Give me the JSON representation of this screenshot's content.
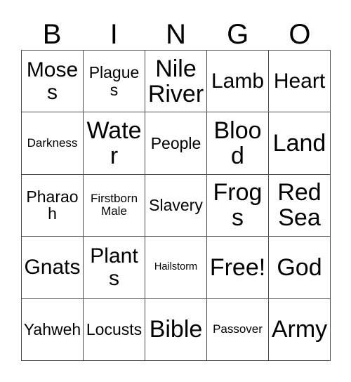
{
  "card": {
    "title_letters": [
      "B",
      "I",
      "N",
      "G",
      "O"
    ],
    "columns": [
      "B",
      "I",
      "N",
      "G",
      "O"
    ],
    "background_color": "#ffffff",
    "text_color": "#000000",
    "border_color": "#4d4d4d",
    "rows": [
      [
        {
          "text": "Moses",
          "size": "lg"
        },
        {
          "text": "Plagues",
          "size": "md"
        },
        {
          "text": "Nile\nRiver",
          "size": "xl"
        },
        {
          "text": "Lamb",
          "size": "lg"
        },
        {
          "text": "Heart",
          "size": "lg"
        }
      ],
      [
        {
          "text": "Darkness",
          "size": "sm"
        },
        {
          "text": "Water",
          "size": "xl"
        },
        {
          "text": "People",
          "size": "md"
        },
        {
          "text": "Blood",
          "size": "xl"
        },
        {
          "text": "Land",
          "size": "xl"
        }
      ],
      [
        {
          "text": "Pharaoh",
          "size": "md"
        },
        {
          "text": "Firstborn\nMale",
          "size": "sm"
        },
        {
          "text": "Slavery",
          "size": "md"
        },
        {
          "text": "Frogs",
          "size": "xl"
        },
        {
          "text": "Red\nSea",
          "size": "xl"
        }
      ],
      [
        {
          "text": "Gnats",
          "size": "lg"
        },
        {
          "text": "Plants",
          "size": "lg"
        },
        {
          "text": "Hailstorm",
          "size": "xs"
        },
        {
          "text": "Free!",
          "size": "xl"
        },
        {
          "text": "God",
          "size": "xl"
        }
      ],
      [
        {
          "text": "Yahweh",
          "size": "md"
        },
        {
          "text": "Locusts",
          "size": "md"
        },
        {
          "text": "Bible",
          "size": "xl"
        },
        {
          "text": "Passover",
          "size": "sm"
        },
        {
          "text": "Army",
          "size": "xl"
        }
      ]
    ]
  }
}
